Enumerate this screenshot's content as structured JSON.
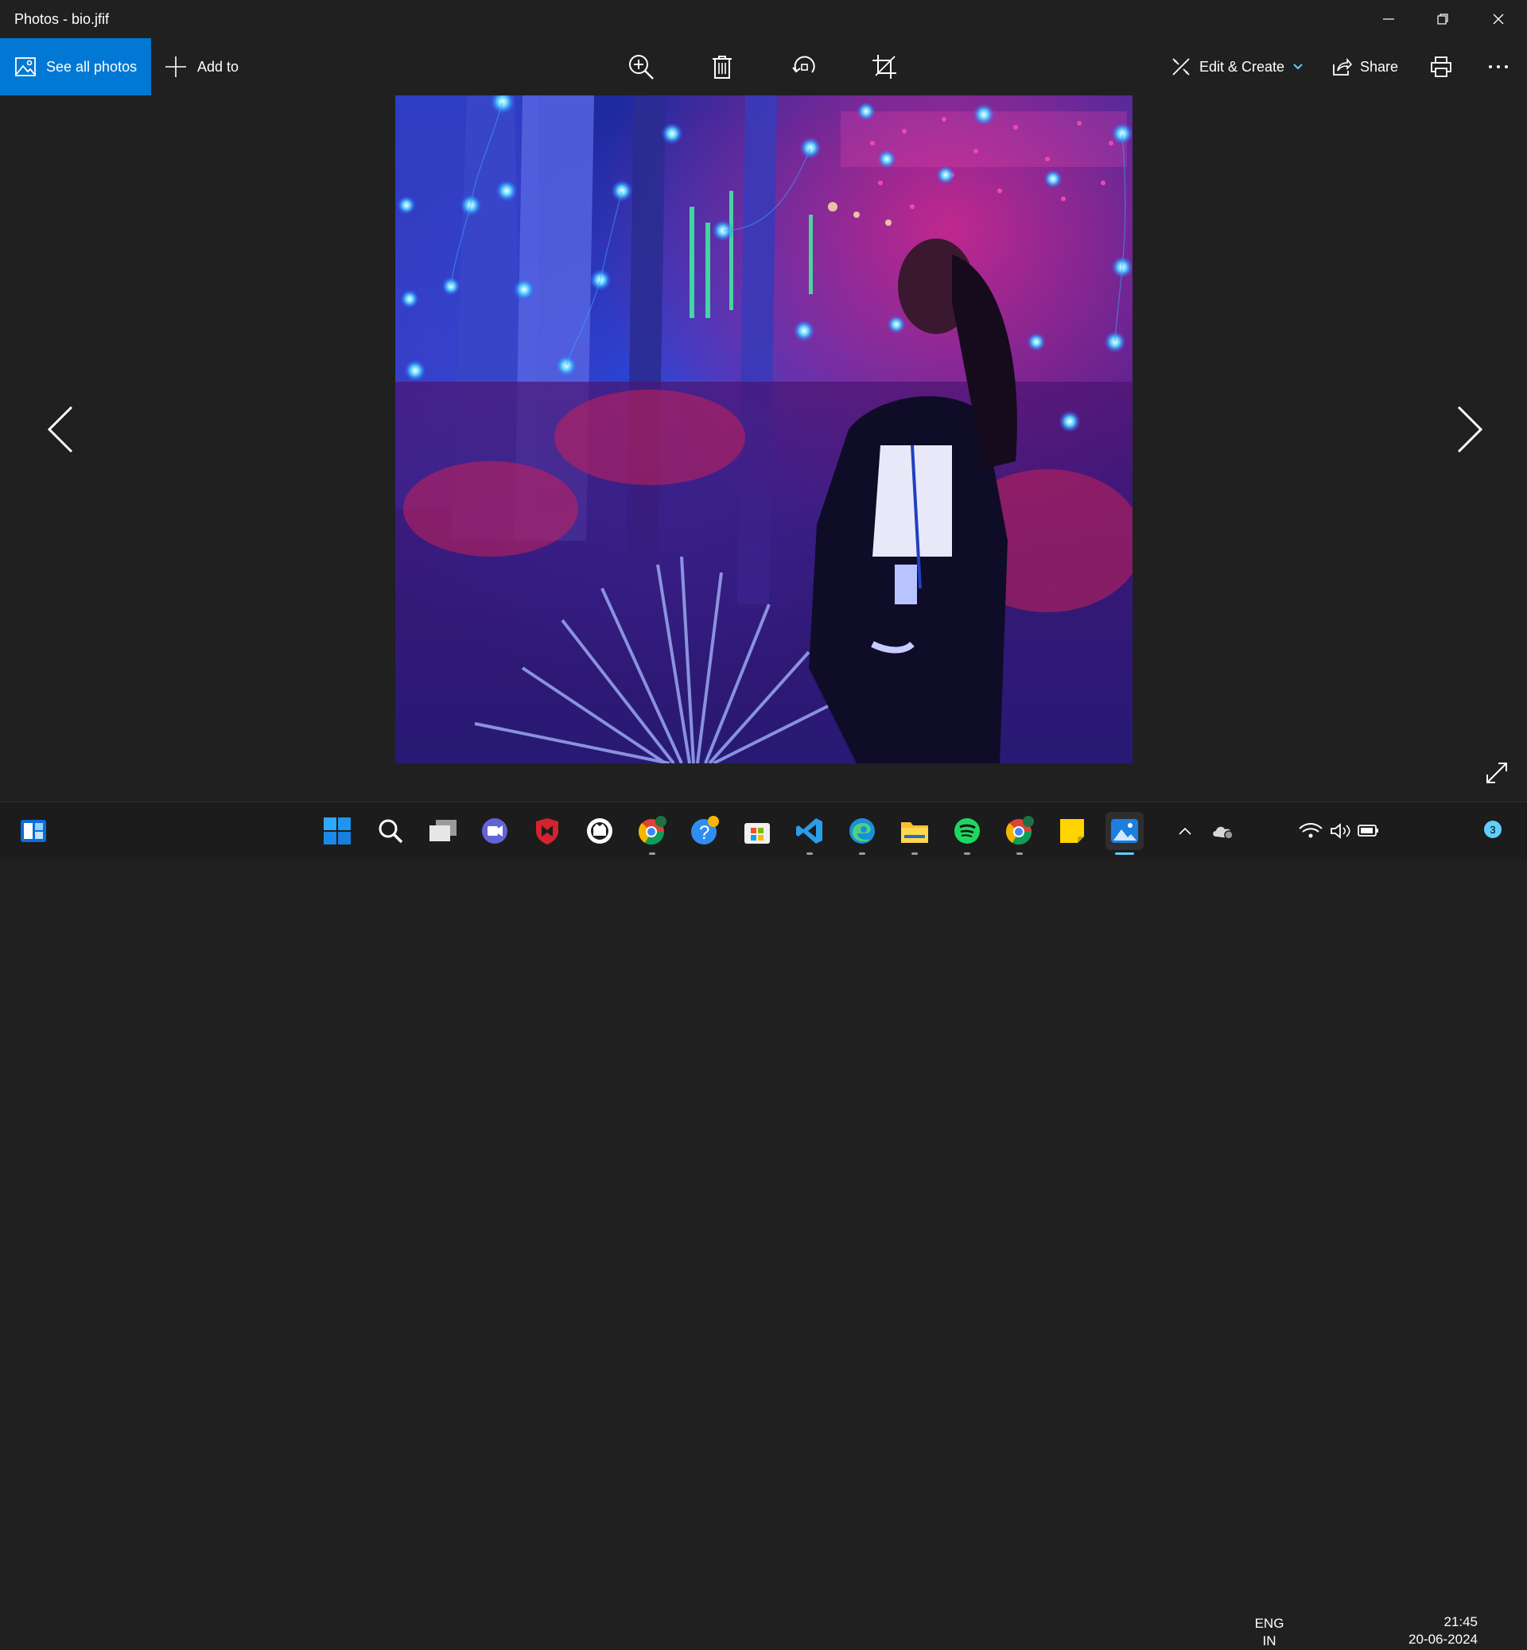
{
  "window": {
    "title": "Photos - bio.jfif",
    "controls": [
      "minimize",
      "restore",
      "close"
    ]
  },
  "toolbar": {
    "see_all_photos": "See all photos",
    "add_to": "Add to",
    "zoom_icon": "zoom-in-icon",
    "delete_icon": "trash-icon",
    "rotate_icon": "rotate-icon",
    "crop_icon": "crop-icon",
    "edit_create": "Edit & Create",
    "share": "Share",
    "print_icon": "print-icon",
    "more_icon": "more-icon"
  },
  "viewer": {
    "image_subject": "woman in black blazer under blue and pink fairy lights"
  },
  "taskbar": {
    "apps": [
      "widgets",
      "start",
      "search",
      "task-view",
      "teams-meet",
      "mcafee",
      "github",
      "chrome",
      "help",
      "microsoft-store",
      "vs-code",
      "edge",
      "file-explorer",
      "spotify",
      "chrome-profile",
      "sticky-notes",
      "photos"
    ],
    "language_line1": "ENG",
    "language_line2": "IN",
    "time": "21:45",
    "date": "20-06-2024",
    "notification_count": "3"
  },
  "colors": {
    "accent": "#0078d4",
    "background": "#202020",
    "taskbar": "#1c1c1c",
    "indicator": "#60cdff"
  }
}
